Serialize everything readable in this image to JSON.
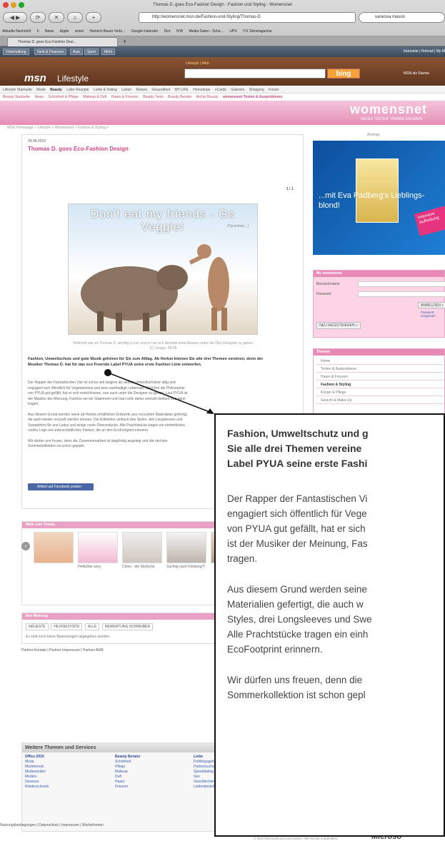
{
  "window_title": "Thomas D. goes Eco-Fashion Design - Fashion und Styling - Womensnet",
  "url": "http://womensnet.msn.de/Fashion-und-Styling/Thomas-D",
  "search_value": "vanessa mason",
  "bookmarks": [
    "Aktuelle Nachricht",
    "h",
    "News",
    "Apple",
    "ciniwi",
    "Heinrich Bauer Verlo...",
    "Google Kalender",
    "Dict",
    "IVW",
    "Media Daten - Sche...",
    "UPS",
    "ITX Skinmagazine"
  ],
  "tab_title": "Thomas D. goes Eco-Fashion Desi...",
  "top_nav": [
    "Unterhaltung",
    "Geld & Finanzen",
    "Auto",
    "Sport",
    "Mehr"
  ],
  "top_links": "Startseite | Hotmail | My M",
  "lifestyle_tab": "Lifestyle | Web",
  "logo_msn": "msn",
  "logo_section": "Lifestyle",
  "bing_label": "bing",
  "msn_start": "MSN als Startse",
  "cat_items": [
    "Lifestyle Startseite",
    "Mode",
    "Beauty",
    "Lafer Rezepte",
    "Liebe & Dating",
    "Leben",
    "Reisen",
    "Gesundheit",
    "MY LIFE",
    "Horoskope",
    "eCards",
    "Galerien",
    "Shopping",
    "Forum"
  ],
  "sub_items": [
    "Beauty Startseite",
    "News",
    "Schönheit & Pflege",
    "Makeup & Duft",
    "Haare & Frisuren",
    "Beauty Tests",
    "Beauty Berater",
    "Archiv Beauty",
    "womensnet Testen & Ausprobieren"
  ],
  "womensnet_logo": "womensnet",
  "womensnet_sub": "NEUES TESTEN. TRENDS ERLEBEN",
  "breadcrumb": "MSN Homepage > Lifestyle > Womensnet > Fashion & Styling >",
  "date": "09.08.2010",
  "headline": "Thomas D. goes Eco-Fashion Design",
  "pager": "1 / 1",
  "photo_title": "Don't eat my friends - Go Veggie!",
  "photo_credit": "(Tierschutz...)",
  "caption": "Vielleicht war es Thomas D. wichtig zu tun und er hat sich deshalb entschlossen unter die Öko-Designer zu gehen. (C) Image: PETA",
  "lead": "Fashion, Umweltschutz und gute Musik gehören für Sie zum Alltag. Ab Herbst können Sie alle drei Themen vereinen, denn der Musiker Thomas D. hat für das eco Freeride Label PYUA seine erste Fashion Linie entworfen.",
  "body_paragraphs": [
    "Der Rapper der Fantastischen Vier ist schon seit langem als aktiver Umweltschützer tätig und engagiert sich öffentlich für Vegetarismus und eine nachhaltige Lebensart. Weil ihm die Philosophie von PYUA gut gefällt, hat er sich entschlossen, nun auch unter die Designer zu gehen. Laut PYUA ist der Musiker der Meinung, Fashion sei ein Statement und man solle daher sinnvoll denken und dann tragen.",
    "Aus diesem Grund werden seine ab Herbst erhältlichen Entwürfe aus recycelten Materialien gefertigt, die auch wieder recycelt werden können. Die Kollektion umfasst drei Styles, drei Longsleeves und Sweatshirts für uns Ladys und einige coole Fleecestücke. Alle Prachtstücke tragen ein einheitliches, cooles Logo mit unterschiedlichen Farben, die an den EcoFootprint erinnern.",
    "Wir dürfen uns freuen, denn die Zusammenarbeit ist langfristig angelegt und die nächste Sommerkollektion ist schon geplant."
  ],
  "fb_button": "Artikel auf Facebook posten",
  "more_header": "Mehr zum Thema",
  "thumb_captions": [
    "",
    "Heftiz/bis sexy",
    "Chino - die Stylische",
    "Süchtig nach Kleidung?!"
  ],
  "rating_header": "Ihre Meinung",
  "rating_tabs": [
    "NEUESTE",
    "HILFREICHSTE",
    "ALLE",
    "BEWERTUNG SCHREIBEN"
  ],
  "rating_none": "Es sind noch keine Bewertungen abgegeben worden.",
  "partner_links": "Partner-Kontakt | Partner-Impressum | Partner-AGB",
  "services_header": "Weitere Themen und Services",
  "service_cols": [
    {
      "title": "Office 2010",
      "items": [
        "Mode",
        "Modetrends",
        "Modesünden",
        "Models",
        "Dessous",
        "Kleiderschrank"
      ]
    },
    {
      "title": "Beauty Berater",
      "items": [
        "Schönheit",
        "Pflege",
        "Makeup",
        "Duft",
        "Haare",
        "Frisuren"
      ]
    },
    {
      "title": "Liebe",
      "items": [
        "Frühlingsgefühle",
        "Partnersuche",
        "Speeddating",
        "Sex",
        "Geschlechter",
        "Liebesbeziehung"
      ]
    }
  ],
  "footer_links": "Nutzungsbedingungen | Datenschutz | Impressum | Werbeformen",
  "copyright": "© 2010 Microsoft und Lizenzarten. Alle Rechte vorbehalten.",
  "ms_logo": "Microso",
  "ad_label": "Anzeige",
  "ad_text": "...mit Eva Padberg's Lieblings-blond!",
  "ad_badge": "Intensive Aufhellung",
  "wbox_header": "My womensnet",
  "wbox_user": "Benutzername",
  "wbox_pass": "Passwort",
  "wbox_login": "ANMELDEN »",
  "wbox_forgot": "Passwort vergessen",
  "wbox_register": "NEU REGISTRIEREN »",
  "themes_header": "Themen",
  "themes_items": [
    "Home",
    "Testen & Ausprobieren",
    "Haare & Frisuren",
    "Fashion & Styling",
    "Körper & Pflege",
    "Gesicht & Make-Up"
  ],
  "zoom_lead": [
    "Fashion, Umweltschutz und g",
    "Sie alle drei Themen vereine",
    "Label PYUA seine erste Fashi"
  ],
  "zoom_body": [
    [
      "Der Rapper der Fantastischen Vi",
      "engagiert sich öffentlich für Vege",
      "von PYUA  gut gefällt, hat er sich",
      "ist der Musiker der Meinung, Fas",
      "tragen."
    ],
    [
      "Aus diesem Grund werden seine",
      "Materialien gefertigt, die auch w",
      "Styles, drei Longsleeves und Swe",
      "Alle Prachtstücke tragen ein einh",
      "EcoFootprint erinnern."
    ],
    [
      "Wir dürfen uns freuen, denn die",
      "Sommerkollektion ist schon gepl"
    ]
  ]
}
